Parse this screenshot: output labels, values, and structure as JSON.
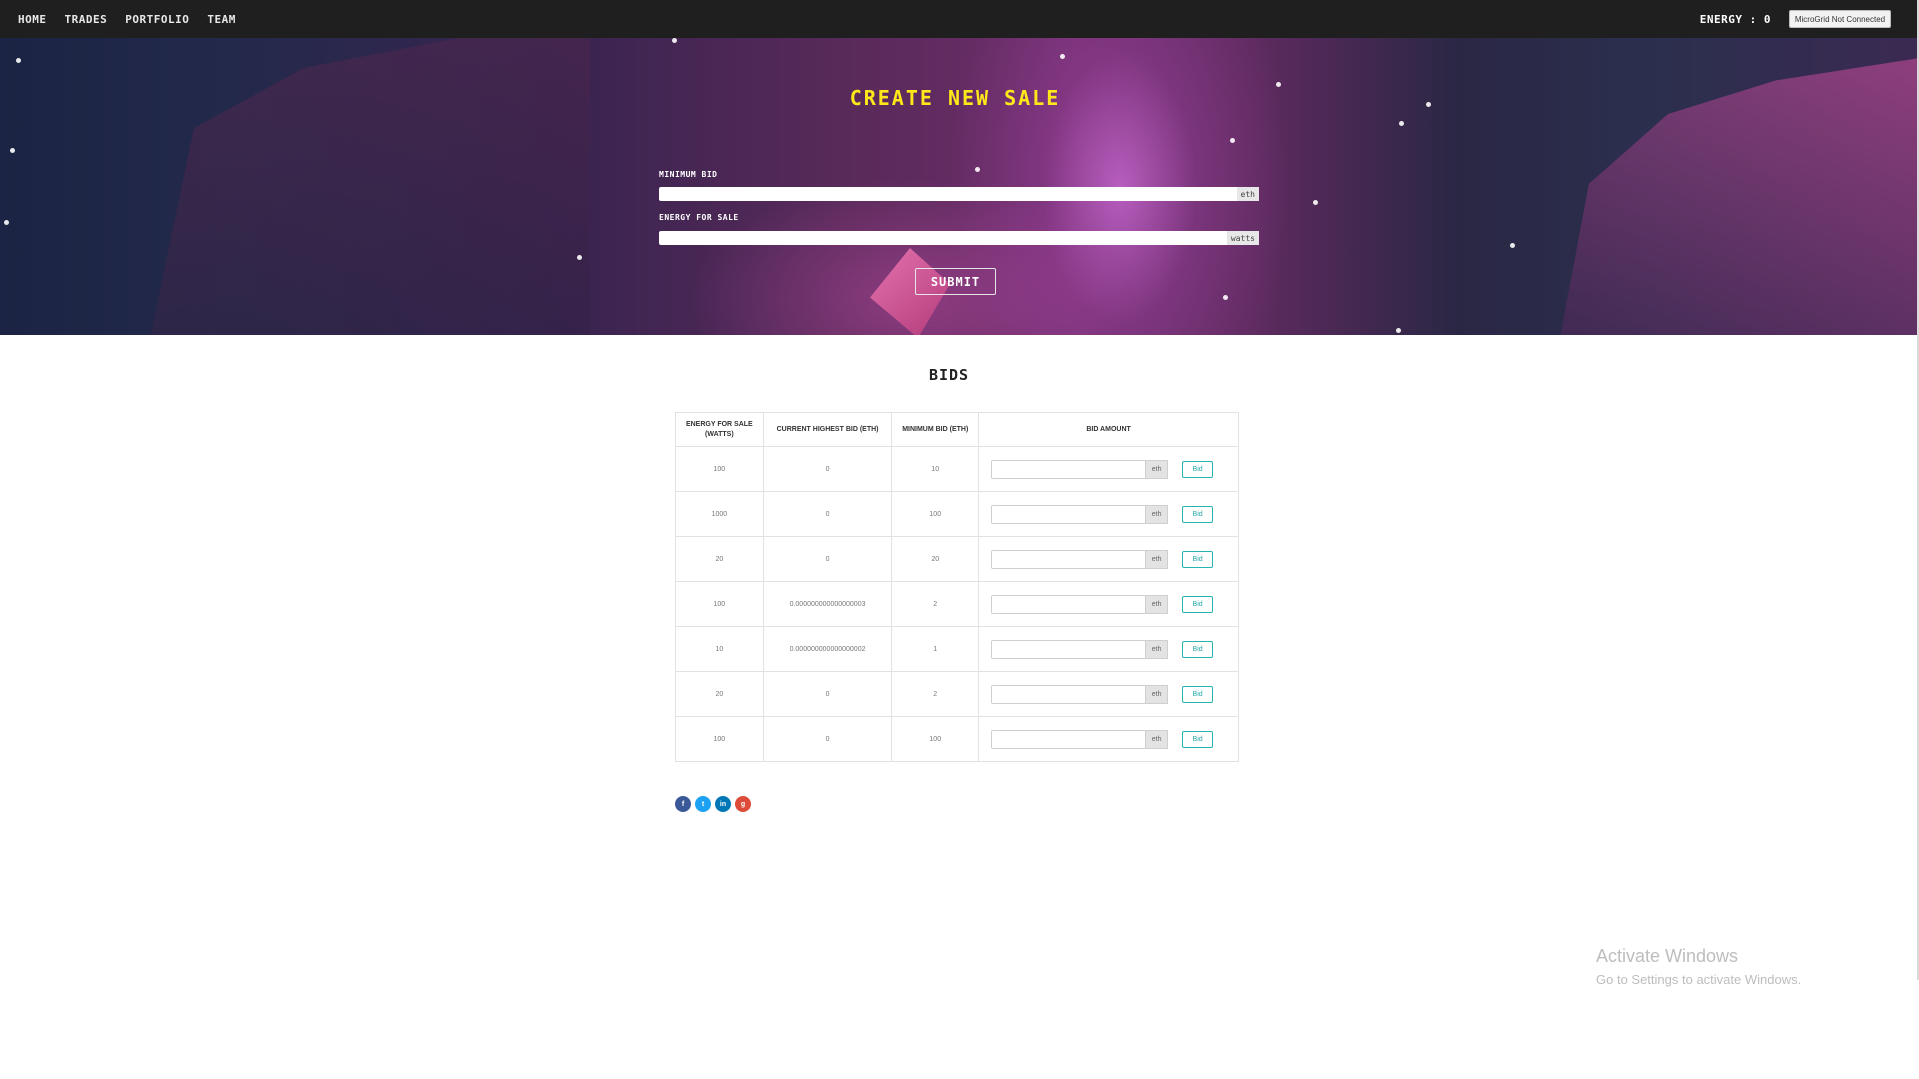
{
  "nav": {
    "links": [
      "HOME",
      "TRADES",
      "PORTFOLIO",
      "TEAM"
    ],
    "energy_label": "ENERGY : 0",
    "microgrid_status": "MicroGrid Not Connected"
  },
  "hero": {
    "title": "CREATE NEW SALE",
    "minimum_bid_label": "MINIMUM BID",
    "minimum_bid_unit": "eth",
    "energy_label": "ENERGY FOR SALE",
    "energy_unit": "watts",
    "submit_label": "SUBMIT"
  },
  "bids": {
    "title": "BIDS",
    "columns": [
      "ENERGY FOR SALE (WATTS)",
      "CURRENT HIGHEST BID (ETH)",
      "MINIMUM BID (ETH)",
      "BID AMOUNT"
    ],
    "unit_label": "eth",
    "button_label": "Bid",
    "rows": [
      {
        "energy": "100",
        "highest": "0",
        "minimum": "10"
      },
      {
        "energy": "1000",
        "highest": "0",
        "minimum": "100"
      },
      {
        "energy": "20",
        "highest": "0",
        "minimum": "20"
      },
      {
        "energy": "100",
        "highest": "0.000000000000000003",
        "minimum": "2"
      },
      {
        "energy": "10",
        "highest": "0.000000000000000002",
        "minimum": "1"
      },
      {
        "energy": "20",
        "highest": "0",
        "minimum": "2"
      },
      {
        "energy": "100",
        "highest": "0",
        "minimum": "100"
      }
    ]
  },
  "social": [
    {
      "name": "facebook-icon",
      "glyph": "f",
      "color": "#3b5998"
    },
    {
      "name": "twitter-icon",
      "glyph": "t",
      "color": "#1da1f2"
    },
    {
      "name": "linkedin-icon",
      "glyph": "in",
      "color": "#0077b5"
    },
    {
      "name": "google-plus-icon",
      "glyph": "g",
      "color": "#dd4b39"
    }
  ],
  "watermark": {
    "title": "Activate Windows",
    "subtitle": "Go to Settings to activate Windows."
  }
}
